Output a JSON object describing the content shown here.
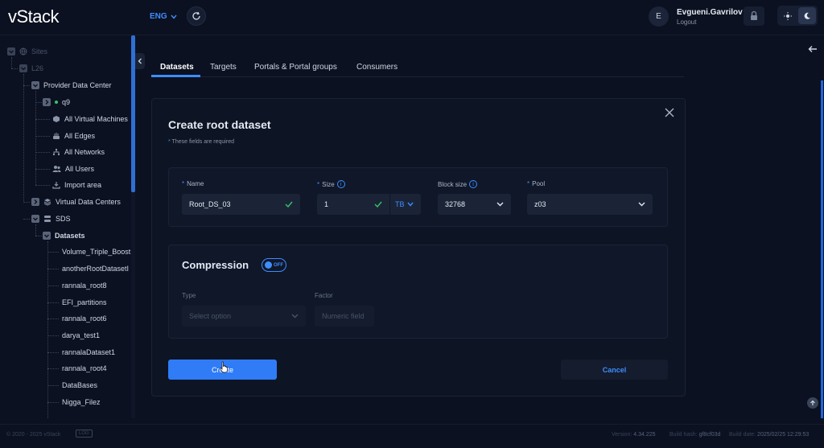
{
  "header": {
    "logo": "vStack",
    "language": "ENG",
    "user_initial": "E",
    "user_name": "Evgueni.Gavrilov",
    "logout_label": "Logout"
  },
  "sidebar": {
    "sites": "Sites",
    "l26": "L26",
    "provider_dc": "Provider Data Center",
    "q9": "q9",
    "all_vms": "All Virtual Machines",
    "all_edges": "All Edges",
    "all_networks": "All Networks",
    "all_users": "All Users",
    "import_area": "Import area",
    "virtual_dcs": "Virtual Data Centers",
    "sds": "SDS",
    "datasets": "Datasets",
    "dataset_items": [
      "Volume_Triple_Boost",
      "anotherRootDatasetI",
      "rannala_root8",
      "EFI_partitions",
      "rannala_root6",
      "darya_test1",
      "rannalaDataset1",
      "rannala_root4",
      "DataBases",
      "Nigga_Filez"
    ]
  },
  "tabs": [
    "Datasets",
    "Targets",
    "Portals & Portal groups",
    "Consumers"
  ],
  "form": {
    "title": "Create root dataset",
    "required_note": "These fields are required",
    "name_label": "Name",
    "name_value": "Root_DS_03",
    "size_label": "Size",
    "size_value": "1",
    "size_unit": "TB",
    "block_size_label": "Block size",
    "block_size_value": "32768",
    "pool_label": "Pool",
    "pool_value": "z03",
    "compression_title": "Compression",
    "compression_toggle": "OFF",
    "type_label": "Type",
    "type_placeholder": "Select option",
    "factor_label": "Factor",
    "factor_placeholder": "Numeric field",
    "create_label": "Create",
    "cancel_label": "Cancel"
  },
  "footer": {
    "copyright": "© 2020 - 2025 vStack",
    "log_button": "LOG",
    "version_label": "Version:",
    "version": "4.34.225",
    "build_label": "Build hash:",
    "build_hash": "gf8cf03d",
    "date_label": "Build date:",
    "build_date": "2025/02/25 12:29:53"
  },
  "colors": {
    "accent": "#3f8cff",
    "background": "#0b1120",
    "panel": "#0d1424",
    "primary_button": "#2f7cf6"
  }
}
